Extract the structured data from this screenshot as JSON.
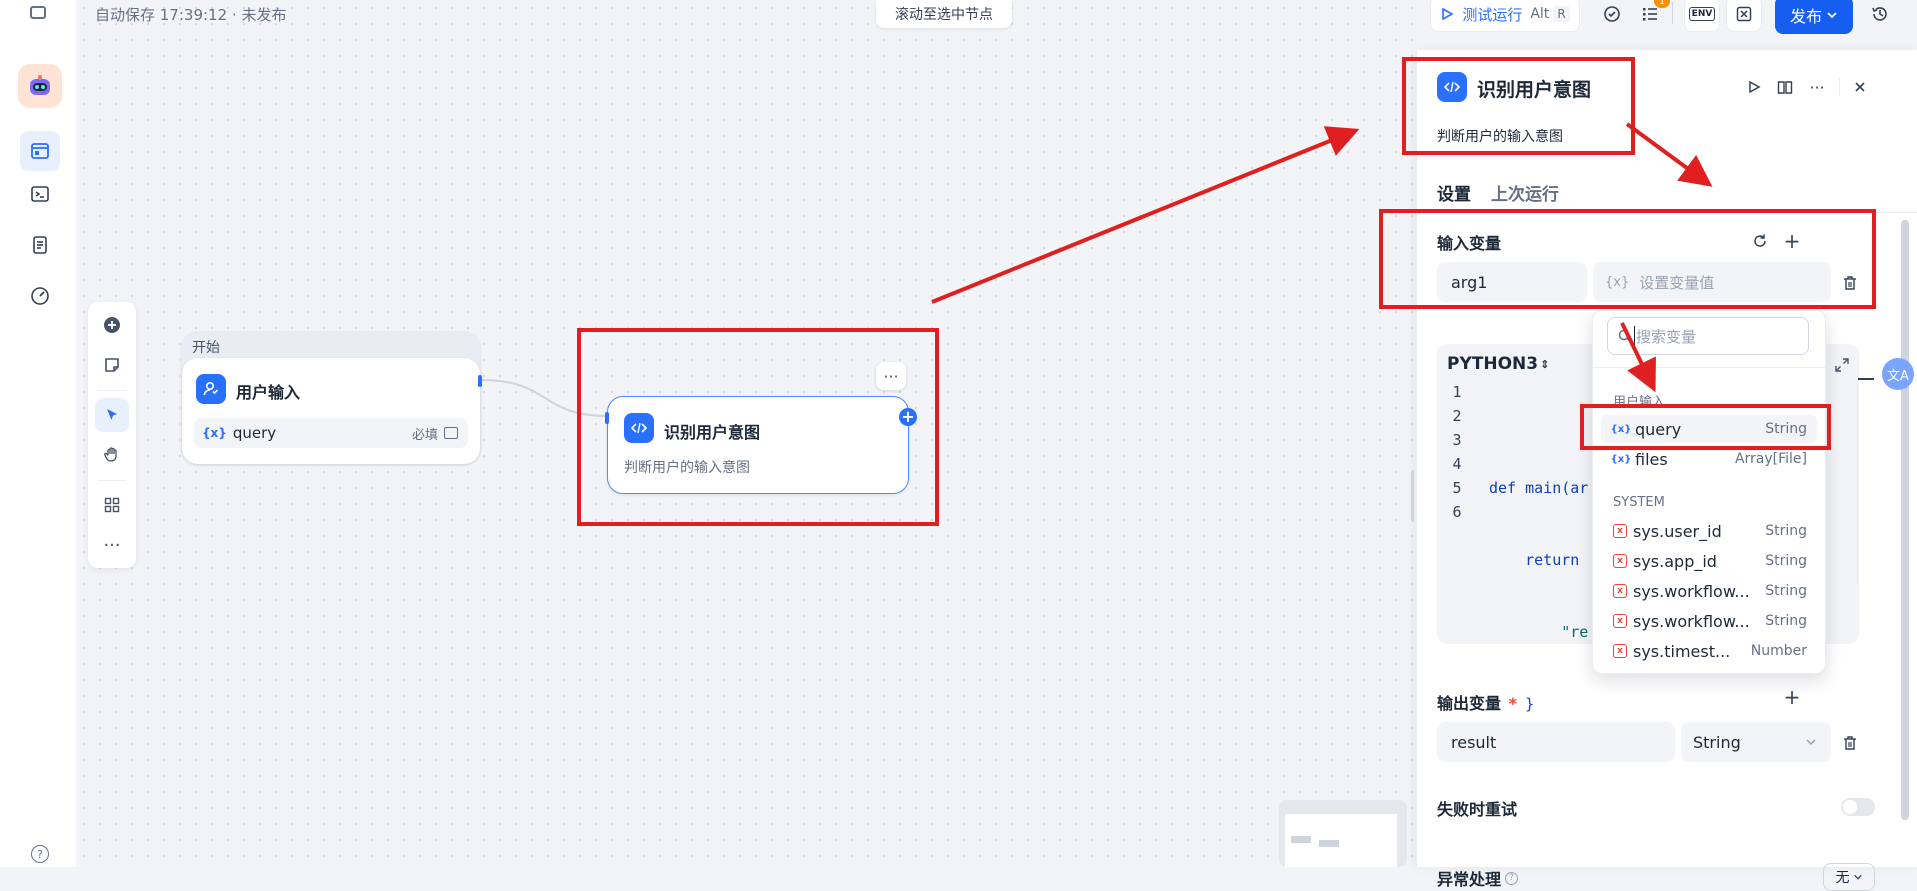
{
  "canvas": {
    "autosave_status": "自动保存 17:39:12 · 未发布",
    "scroll_to_selected": "滚动至选中节点"
  },
  "toolbar_right": {
    "test_run_label": "测试运行",
    "shortcut_alt": "Alt",
    "shortcut_key": "R",
    "badge_count": "1",
    "env_label": "ENV",
    "publish_label": "发布"
  },
  "start_node": {
    "group_label": "开始",
    "title": "用户输入",
    "var_name": "query",
    "required_label": "必填"
  },
  "code_node": {
    "title": "识别用户意图",
    "description": "判断用户的输入意图"
  },
  "panel": {
    "title": "识别用户意图",
    "description": "判断用户的输入意图",
    "tabs": [
      "设置",
      "上次运行"
    ],
    "input_section_label": "输入变量",
    "input_var_name": "arg1",
    "input_var_placeholder": "设置变量值",
    "language": "PYTHON3",
    "code_line_numbers": [
      "1",
      "2",
      "3",
      "4",
      "5",
      "6"
    ],
    "code_lines": [
      "",
      "def main(ar",
      "    return",
      "        \"re",
      "    }",
      ""
    ],
    "output_section_label": "输出变量",
    "required_mark": "*",
    "output_var_name": "result",
    "output_var_type": "String",
    "retry_label": "失败时重试",
    "error_label": "异常处理",
    "error_value": "无"
  },
  "dropdown": {
    "search_placeholder": "搜索变量",
    "user_group_label": "用户输入",
    "user_items": [
      {
        "name": "query",
        "type": "String"
      },
      {
        "name": "files",
        "type": "Array[File]"
      }
    ],
    "system_group_label": "SYSTEM",
    "system_items": [
      {
        "name": "sys.user_id",
        "type": "String"
      },
      {
        "name": "sys.app_id",
        "type": "String"
      },
      {
        "name": "sys.workflow...",
        "type": "String"
      },
      {
        "name": "sys.workflow...",
        "type": "String"
      },
      {
        "name": "sys.timest...",
        "type": "Number"
      }
    ]
  },
  "colors": {
    "accent": "#2970ff",
    "annotation_red": "#e02020"
  }
}
